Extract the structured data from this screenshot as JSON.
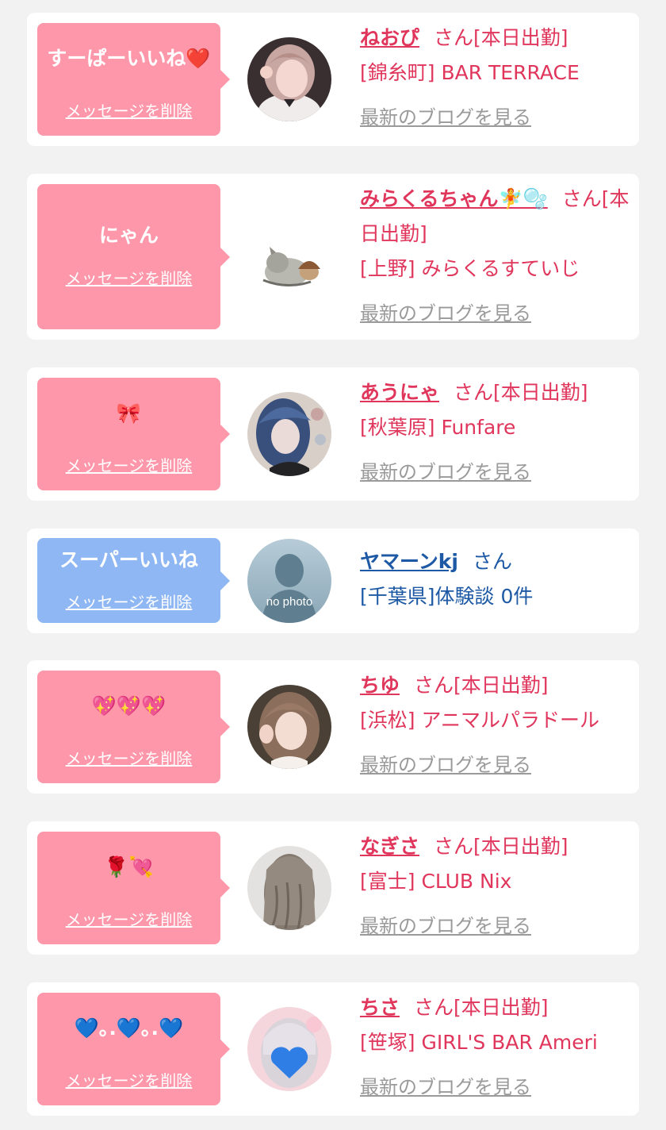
{
  "delete_label": "メッセージを削除",
  "blog_label": "最新のブログを見る",
  "items": [
    {
      "message": "すーぱーいいね❤️",
      "name": "ねおぴ",
      "suffix": "さん[本日出勤]",
      "shop": "[錦糸町] BAR TERRACE",
      "show_blog": true
    },
    {
      "message": "にゃん",
      "name": "みらくるちゃん🧚🫧",
      "suffix": "さん[本日出勤]",
      "shop": "[上野] みらくるすていじ",
      "show_blog": true
    },
    {
      "message": "🎀",
      "name": "あうにゃ",
      "suffix": "さん[本日出勤]",
      "shop": "[秋葉原] Funfare",
      "show_blog": true
    },
    {
      "message": "スーパーいいね",
      "name": "ヤマーンkj",
      "suffix": "さん",
      "shop": "[千葉県]体験談 0件",
      "avatar_text": "no photo",
      "show_blog": false
    },
    {
      "message": "💖💖💖",
      "name": "ちゆ",
      "suffix": "さん[本日出勤]",
      "shop": "[浜松] アニマルパラドール",
      "show_blog": true
    },
    {
      "message": "🌹💘",
      "name": "なぎさ",
      "suffix": "さん[本日出勤]",
      "shop": "[富士] CLUB Nix",
      "show_blog": true
    },
    {
      "message": "💙｡.💙｡.💙",
      "name": "ちさ",
      "suffix": "さん[本日出勤]",
      "shop": "[笹塚] GIRL'S BAR Ameri",
      "show_blog": true
    }
  ],
  "colors": {
    "page_bg": "#f2f2f2",
    "card_bg": "#ffffff",
    "pink_bubble": "#fd97a9",
    "blue_bubble": "#8fb7f3",
    "pink_text": "#e0365c",
    "blue_text": "#1d59a5",
    "blog_link": "#9a9a9a"
  }
}
